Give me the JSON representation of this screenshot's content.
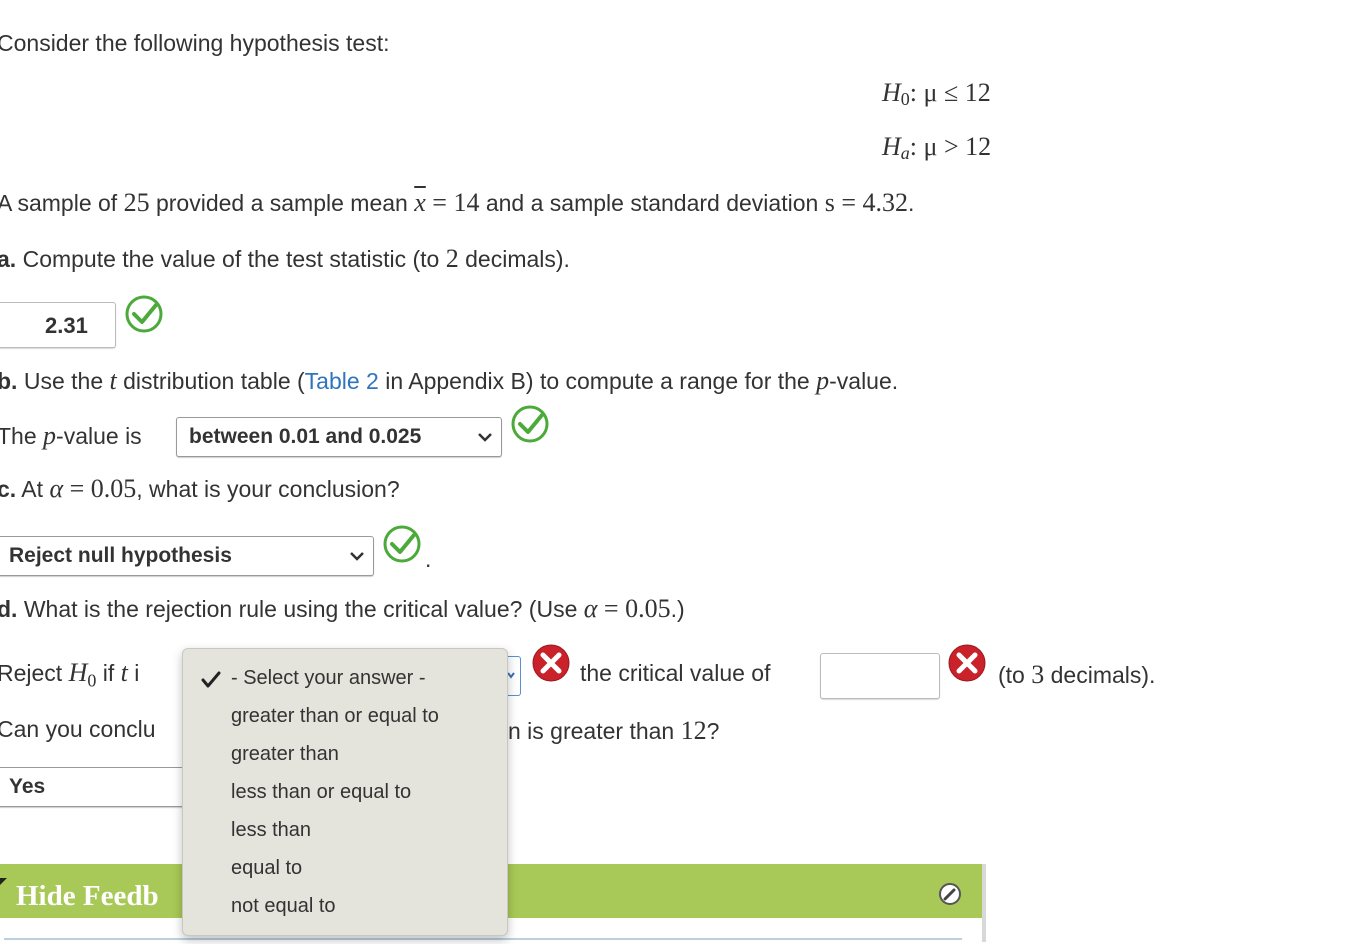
{
  "intro": "Consider the following hypothesis test:",
  "hypotheses": {
    "h0_sym": "H",
    "h0_sub": "0",
    "h0_rel": ": μ ≤ 12",
    "ha_sym": "H",
    "ha_sub": "a",
    "ha_rel": ": μ > 12"
  },
  "sample": {
    "pre": "A sample of ",
    "n": "25",
    "mid1": " provided a sample mean ",
    "xbar": "x",
    "eq1": " = ",
    "mean": "14",
    "mid2": " and a sample standard deviation ",
    "s": "s",
    "eq2": " = ",
    "sd": "4.32",
    "end": "."
  },
  "part_a": {
    "label": "a.",
    "text1": " Compute the value of the test statistic (to ",
    "num": "2",
    "text2": " decimals).",
    "answer": "2.31"
  },
  "part_b": {
    "label": "b.",
    "t1": " Use the ",
    "t": "t",
    "t2": " distribution table (",
    "link": "Table 2",
    "t3": " in Appendix B) to compute a range for the ",
    "p": "p",
    "t4": "-value.",
    "row_pre": "The ",
    "row_p": "p",
    "row_post": "-value is",
    "selected": "between 0.01 and 0.025"
  },
  "part_c": {
    "label": "c.",
    "t1": " At ",
    "alpha": "α",
    "eq": " = ",
    "val": "0.05",
    "t2": ", what is your conclusion?",
    "selected": "Reject null hypothesis",
    "period": "."
  },
  "part_d": {
    "label": "d.",
    "t1": " What is the rejection rule using the critical value? (Use ",
    "alpha": "α",
    "eq": " = ",
    "val": "0.05",
    "t2": ".)",
    "reject_pre": "Reject ",
    "h": "H",
    "hsub": "0",
    "if": " if ",
    "t": "t",
    "is": " i",
    "crit_text": "the critical value of",
    "crit_value": "",
    "to_pre": "(to ",
    "to_num": "3",
    "to_post": " decimals)."
  },
  "part_e": {
    "pre": "Can you conclu",
    "post": "n is greater than ",
    "num": "12",
    "q": "?",
    "selected": "Yes"
  },
  "dropdown_menu": {
    "options": [
      "- Select your answer -",
      "greater than or equal to",
      "greater than",
      "less than or equal to",
      "less than",
      "equal to",
      "not equal to"
    ],
    "checked_index": 0
  },
  "feedback": {
    "label": "Hide Feedb"
  },
  "colors": {
    "correct": "#4caa3a",
    "wrong": "#c9222a",
    "link": "#2f74c0",
    "feedback_bar": "#a8c957"
  }
}
